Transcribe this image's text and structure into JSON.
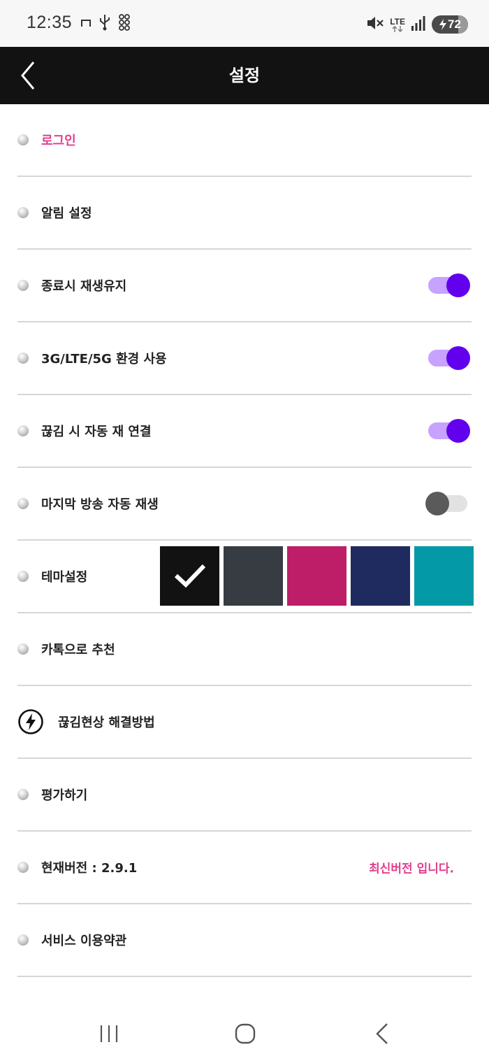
{
  "status_bar": {
    "time": "12:35",
    "network": "LTE",
    "battery": "72",
    "icons": [
      "ribbon-icon",
      "usb-icon",
      "grid-icon",
      "mute-icon",
      "lte-icon",
      "signal-icon",
      "battery-icon"
    ]
  },
  "header": {
    "title": "설정",
    "back_icon": "chevron-left-icon"
  },
  "settings": {
    "login": "로그인",
    "notifications": "알림 설정",
    "keep_playing": {
      "label": "종료시 재생유지",
      "on": true
    },
    "mobile_data": {
      "label": "3G/LTE/5G 환경 사용",
      "on": true
    },
    "auto_reconnect": {
      "label": "끊김 시 자동 재 연결",
      "on": true
    },
    "autoplay_last": {
      "label": "마지막 방송 자동 재생",
      "on": false
    },
    "theme": {
      "label": "테마설정",
      "swatches": [
        "#121212",
        "#373c43",
        "#be1e68",
        "#1f2a5e",
        "#0399a6"
      ],
      "selected_index": 0
    },
    "recommend": "카톡으로 추천",
    "troubleshoot": "끊김현상 해결방법",
    "rate": "평가하기",
    "version": {
      "label": "현재버전 : 2.9.1",
      "status": "최신버전 입니다."
    },
    "terms": "서비스 이용약관"
  },
  "colors": {
    "accent_pink": "#e0408e",
    "toggle_on": "#6200ee",
    "toggle_track_on": "#c7a2ff",
    "header_bg": "#121212"
  },
  "nav_bar": {
    "icons": [
      "recent-apps-icon",
      "home-icon",
      "back-icon"
    ]
  }
}
